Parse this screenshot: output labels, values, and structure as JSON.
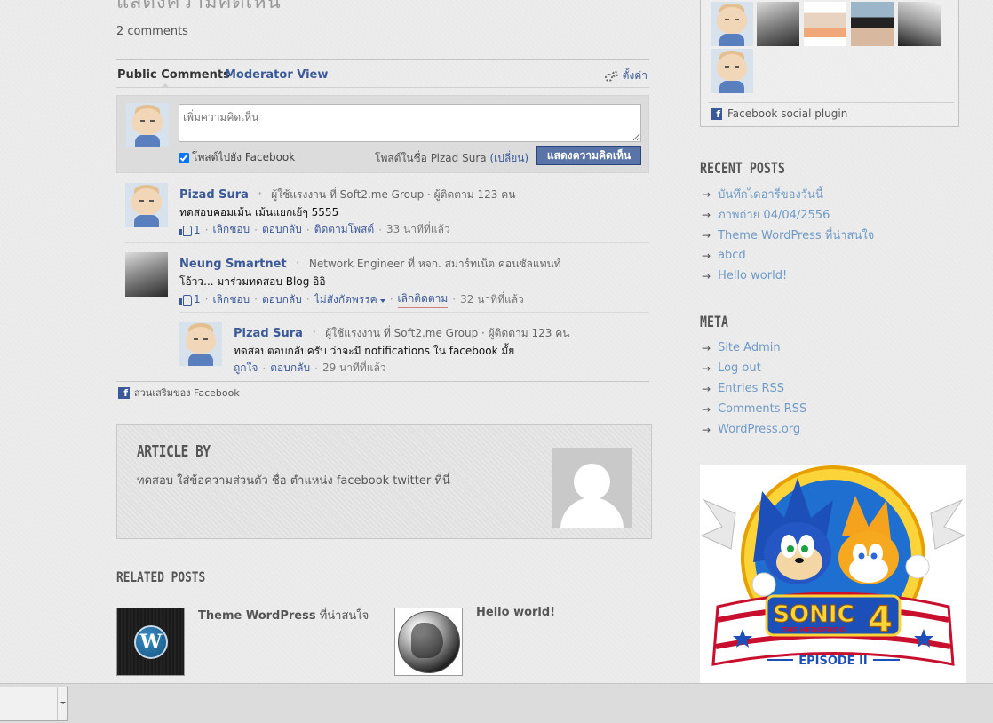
{
  "post": {
    "title_fragment": "แสดงความคิดเห็น",
    "comments_count": "2 comments"
  },
  "fb_comments": {
    "tab_public": "Public Comments",
    "tab_separator": "·",
    "tab_moderator": "Moderator View",
    "settings_label": "ตั้งค่า",
    "compose": {
      "placeholder": "เพิ่มความคิดเห็น",
      "post_to_facebook_label": "โพสต์ไปยัง Facebook",
      "post_to_facebook_checked": true,
      "posting_as_prefix": "โพสต์ในชื่อ Pizad Sura",
      "change_label": "(เปลี่ยน)",
      "submit_label": "แสดงความคิดเห็น"
    },
    "comments": [
      {
        "name": "Pizad Sura",
        "meta": "ผู้ใช้แรงงาน ที่ Soft2.me Group · ผู้ติดตาม 123 คน",
        "text": "ทดสอบคอมเม้น เม้นแยกเย้ๆ 5555",
        "like_count": "1",
        "action_unlike": "เลิกชอบ",
        "action_reply": "ตอบกลับ",
        "action_extra": "ติดตามโพสต์",
        "time": "33 นาทีที่แล้ว"
      },
      {
        "name": "Neung Smartnet",
        "meta": "Network Engineer ที่ หจก. สมาร์ทเน็ต คอนซัลแทนท์",
        "text": "โอ้วว... มาร่วมทดสอบ Blog อิอิ",
        "like_count": "1",
        "action_unlike": "เลิกชอบ",
        "action_reply": "ตอบกลับ",
        "action_extra": "ไม่สังกัดพรรค",
        "action_unfollow": "เลิกติดตาม",
        "time": "32 นาทีที่แล้ว"
      }
    ],
    "reply": {
      "name": "Pizad Sura",
      "meta": "ผู้ใช้แรงงาน ที่ Soft2.me Group · ผู้ติดตาม 123 คน",
      "text": "ทดสอบตอบกลับครับ ว่าจะมี notifications ใน facebook มั้ย",
      "action_like": "ถูกใจ",
      "action_reply": "ตอบกลับ",
      "time": "29 นาทีที่แล้ว"
    },
    "footer_label": "ส่วนเสริมของ Facebook"
  },
  "author_box": {
    "heading": "ARTICLE BY",
    "bio": "ทดสอบ ใส่ข้อความส่วนตัว ชื่อ ตำแหน่ง facebook twitter ที่นี่"
  },
  "related": {
    "heading": "RELATED POSTS",
    "items": [
      {
        "title_bold": "Theme WordPress",
        "title_normal": " ที่น่าสนใจ"
      },
      {
        "title_bold": "Hello world!",
        "title_normal": ""
      }
    ]
  },
  "sidebar": {
    "plugin_label": "Facebook social plugin",
    "recent_heading": "RECENT POSTS",
    "recent_posts": [
      "บันทึกไดอารี่ของวันนี้",
      "ภาพถ่าย 04/04/2556",
      "Theme WordPress ที่น่าสนใจ",
      "abcd",
      "Hello world!"
    ],
    "meta_heading": "META",
    "meta_links": [
      "Site Admin",
      "Log out",
      "Entries RSS",
      "Comments RSS",
      "WordPress.org"
    ],
    "ad": {
      "title": "SONIC",
      "subtitle": "THE HEDGEHOG",
      "number": "4",
      "episode": "EPISODE II"
    }
  },
  "icons": {
    "settings": "gear-icon",
    "like": "thumbs-up-icon",
    "facebook": "facebook-icon",
    "arrow": "arrow-right-icon"
  },
  "colors": {
    "facebook_blue": "#3b5998",
    "sidebar_link": "#6f9ac6",
    "submit_button": "#5b74a8"
  }
}
